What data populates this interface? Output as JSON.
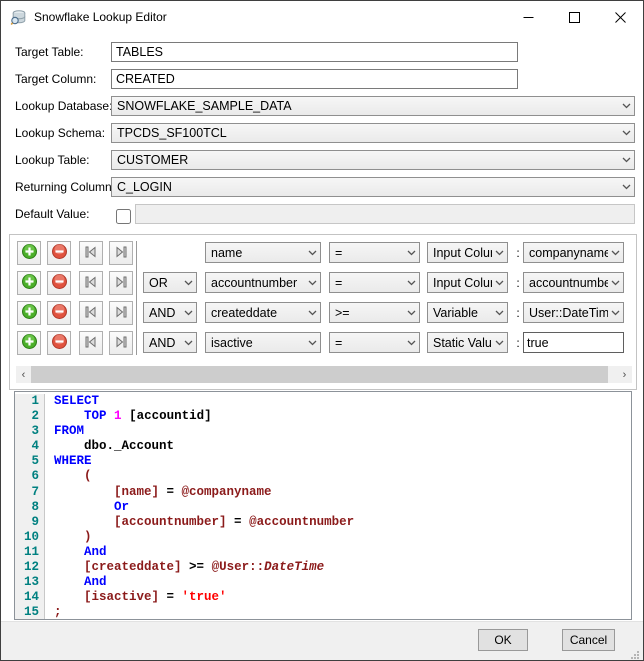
{
  "window": {
    "title": "Snowflake Lookup Editor",
    "title_icon": "database-search-icon",
    "caption_buttons": [
      "minimize",
      "maximize",
      "close"
    ]
  },
  "fields": [
    {
      "label": "Target Table:",
      "value": "TABLES",
      "type": "text"
    },
    {
      "label": "Target Column:",
      "value": "CREATED",
      "type": "text"
    },
    {
      "label": "Lookup Database:",
      "value": "SNOWFLAKE_SAMPLE_DATA",
      "type": "combo"
    },
    {
      "label": "Lookup Schema:",
      "value": "TPCDS_SF100TCL",
      "type": "combo"
    },
    {
      "label": "Lookup Table:",
      "value": "CUSTOMER",
      "type": "combo"
    },
    {
      "label": "Returning Column:",
      "value": "C_LOGIN",
      "type": "combo"
    },
    {
      "label": "Default Value:",
      "value": "",
      "type": "checkbox-text",
      "checked": false
    }
  ],
  "conditions": {
    "separator": ":",
    "row_icons": [
      "plus-circle-icon",
      "minus-circle-icon",
      "skip-first-icon",
      "skip-last-icon"
    ],
    "rows": [
      {
        "conjunction": null,
        "field": "name",
        "operator": "=",
        "value_type": "Input Column",
        "value": "companyname",
        "value_kind": "combo"
      },
      {
        "conjunction": "OR",
        "field": "accountnumber",
        "operator": "=",
        "value_type": "Input Column",
        "value": "accountnumber",
        "value_kind": "combo"
      },
      {
        "conjunction": "AND",
        "field": "createddate",
        "operator": ">=",
        "value_type": "Variable",
        "value": "User::DateTime",
        "value_kind": "combo"
      },
      {
        "conjunction": "AND",
        "field": "isactive",
        "operator": "=",
        "value_type": "Static Value",
        "value": "true",
        "value_kind": "text"
      }
    ],
    "scrollbar": {
      "left_arrow": "‹",
      "right_arrow": "›"
    }
  },
  "sql": {
    "lines": [
      {
        "n": 1,
        "tokens": [
          [
            "SELECT",
            "kw"
          ]
        ]
      },
      {
        "n": 2,
        "tokens": [
          [
            "    ",
            "pl"
          ],
          [
            "TOP",
            "kw"
          ],
          [
            " ",
            "pl"
          ],
          [
            "1",
            "num"
          ],
          [
            " ",
            "pl"
          ],
          [
            "[accountid]",
            "pl"
          ]
        ]
      },
      {
        "n": 3,
        "tokens": [
          [
            "FROM",
            "kw"
          ]
        ]
      },
      {
        "n": 4,
        "tokens": [
          [
            "    dbo._Account",
            "pl"
          ]
        ]
      },
      {
        "n": 5,
        "tokens": [
          [
            "WHERE",
            "kw"
          ]
        ]
      },
      {
        "n": 6,
        "tokens": [
          [
            "    ",
            "pl"
          ],
          [
            "(",
            "mar"
          ]
        ]
      },
      {
        "n": 7,
        "tokens": [
          [
            "        ",
            "pl"
          ],
          [
            "[name]",
            "mar"
          ],
          [
            " = ",
            "pl"
          ],
          [
            "@companyname",
            "mar"
          ]
        ]
      },
      {
        "n": 8,
        "tokens": [
          [
            "        ",
            "pl"
          ],
          [
            "Or",
            "kw"
          ]
        ]
      },
      {
        "n": 9,
        "tokens": [
          [
            "        ",
            "pl"
          ],
          [
            "[accountnumber]",
            "mar"
          ],
          [
            " = ",
            "pl"
          ],
          [
            "@accountnumber",
            "mar"
          ]
        ]
      },
      {
        "n": 10,
        "tokens": [
          [
            "    ",
            "pl"
          ],
          [
            ")",
            "mar"
          ]
        ]
      },
      {
        "n": 11,
        "tokens": [
          [
            "    ",
            "pl"
          ],
          [
            "And",
            "kw"
          ]
        ]
      },
      {
        "n": 12,
        "tokens": [
          [
            "    ",
            "pl"
          ],
          [
            "[createddate]",
            "mar"
          ],
          [
            " >= ",
            "pl"
          ],
          [
            "@User::",
            "mar"
          ],
          [
            "DateTime",
            "marit"
          ]
        ]
      },
      {
        "n": 13,
        "tokens": [
          [
            "    ",
            "pl"
          ],
          [
            "And",
            "kw"
          ]
        ]
      },
      {
        "n": 14,
        "tokens": [
          [
            "    ",
            "pl"
          ],
          [
            "[isactive]",
            "mar"
          ],
          [
            " = ",
            "pl"
          ],
          [
            "'true'",
            "str"
          ]
        ]
      },
      {
        "n": 15,
        "tokens": [
          [
            ";",
            "mar"
          ]
        ]
      }
    ]
  },
  "footer": {
    "ok": "OK",
    "cancel": "Cancel"
  },
  "colors": {
    "keyword": "#0000ff",
    "number_literal": "#ff00ff",
    "identifier": "#000000",
    "maroon_token": "#8b1a1a",
    "string_literal": "#ff0000",
    "line_number": "#008080",
    "add_button_green": "#4caf2a",
    "remove_button_red": "#e0523f",
    "footer_bg": "#f0f0f0"
  }
}
